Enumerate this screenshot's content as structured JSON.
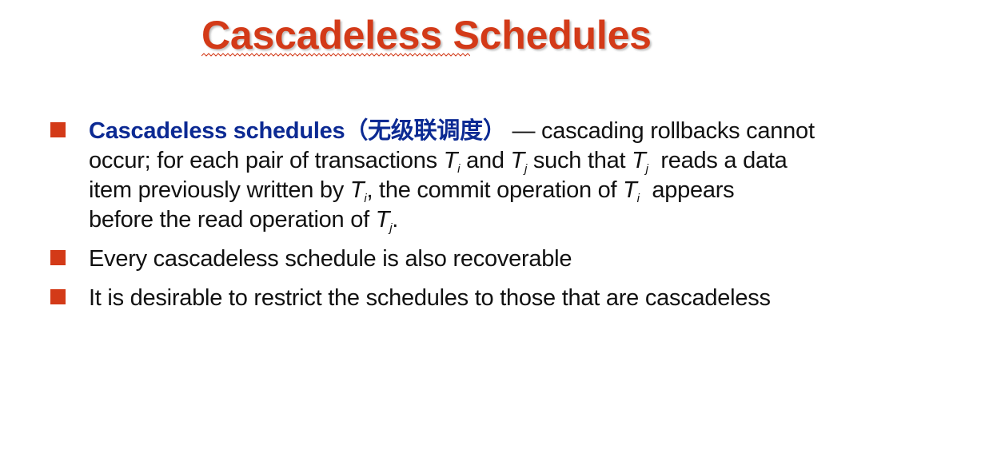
{
  "slide": {
    "title": "Cascadeless Schedules",
    "accent_color": "#d33a18",
    "term_color": "#0c2a93",
    "bullets": [
      {
        "term": "Cascadeless schedules",
        "term_cn": "（无级联调度）",
        "dash": " — ",
        "l1_end": "cascading rollbacks cannot",
        "l2_a": "occur; for each pair of transactions ",
        "l2_t1": "T",
        "l2_s1": "i",
        "l2_b": " and ",
        "l2_t2": "T",
        "l2_s2": "j",
        "l2_c": " such that ",
        "l2_t3": "T",
        "l2_s3": "j",
        "l2_d": "  reads a data",
        "l3_a": "item previously written by ",
        "l3_t1": "T",
        "l3_s1": "i",
        "l3_b": ", the commit operation of ",
        "l3_t2": "T",
        "l3_s2": "i",
        "l3_c": "  appears",
        "l4_a": "before the read operation of ",
        "l4_t1": "T",
        "l4_s1": "j",
        "l4_b": "."
      },
      {
        "text": "Every cascadeless schedule is also recoverable"
      },
      {
        "text": "It is desirable to restrict the schedules to those that are cascadeless"
      }
    ]
  }
}
